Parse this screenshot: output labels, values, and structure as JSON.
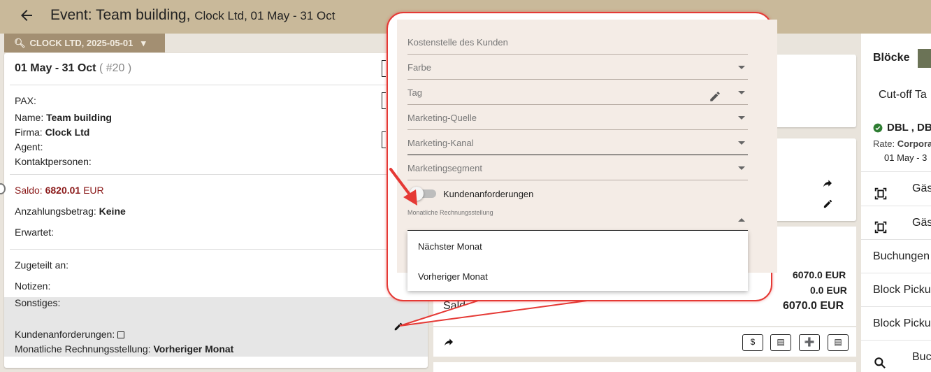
{
  "header": {
    "title": "Event: Team building,",
    "subtitle": "Clock Ltd, 01 May - 31 Oct",
    "filter_label": "CLOCK LTD, 2025-05-01"
  },
  "event": {
    "date_range": "01 May - 31 Oct",
    "event_id": "( #20 )",
    "pax_label": "PAX:",
    "name_label": "Name:",
    "name_value": "Team building",
    "firma_label": "Firma:",
    "firma_value": "Clock Ltd",
    "agent_label": "Agent:",
    "kontakt_label": "Kontaktpersonen:",
    "saldo_label": "Saldo:",
    "saldo_value": "6820.01",
    "saldo_currency": "EUR",
    "anzahlung_label": "Anzahlungsbetrag:",
    "anzahlung_value": "Keine",
    "erwartet_label": "Erwartet:",
    "zugeteilt_label": "Zugeteilt an:",
    "notizen_label": "Notizen:",
    "sonstiges_label": "Sonstiges:",
    "kundenanf_label": "Kundenanforderungen:",
    "monatliche_label": "Monatliche Rechnungsstellung:",
    "monatliche_value": "Vorheriger Monat"
  },
  "middle": {
    "amount1": "6070.0 EUR",
    "amount2": "0.0 EUR",
    "saldo_label": "Saldo:",
    "saldo_value": "6070.0 EUR"
  },
  "sidebar": {
    "bloecke_label": "Blöcke",
    "cutoff_label": "Cut-off Ta",
    "room_label": "DBL , DB",
    "rate_label": "Rate:",
    "rate_value": "Corpora",
    "rate_dates": "01 May - 3",
    "items": [
      {
        "label": "Gäs"
      },
      {
        "label": "Gäs"
      },
      {
        "label": "Buchungen"
      },
      {
        "label": "Block Picku"
      },
      {
        "label": "Block Picku"
      },
      {
        "label": "Buc"
      }
    ]
  },
  "popup": {
    "fields": [
      {
        "label": "Kostenstelle des Kunden"
      },
      {
        "label": "Farbe"
      },
      {
        "label": "Tag"
      },
      {
        "label": "Marketing-Quelle"
      },
      {
        "label": "Marketing-Kanal"
      },
      {
        "label": "Marketingsegment"
      }
    ],
    "toggle_label": "Kundenanforderungen",
    "monthly_label": "Monatliche Rechnungsstellung",
    "options": [
      "Nächster Monat",
      "Vorheriger Monat"
    ]
  },
  "colors": {
    "header_bg": "#c9b99a",
    "filter_bg": "#a38f72",
    "saldo_red": "#8b1a1a",
    "callout_red": "#e53935"
  }
}
